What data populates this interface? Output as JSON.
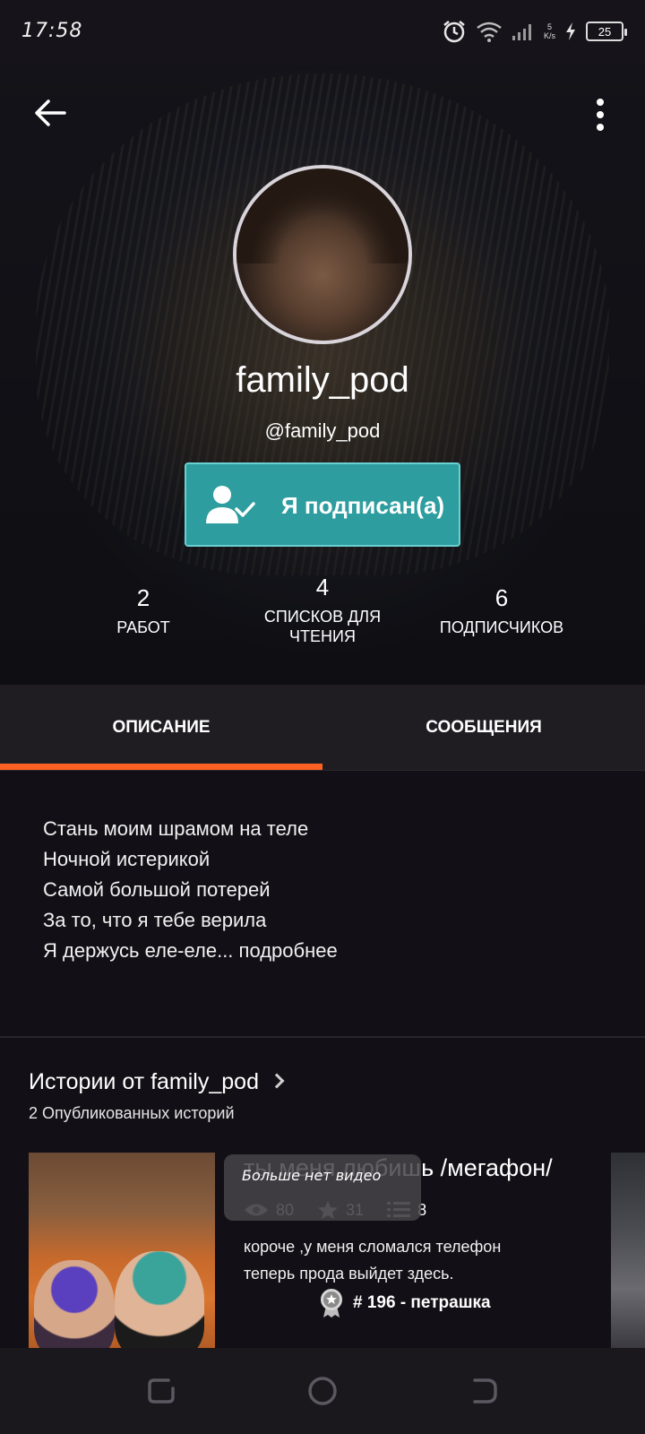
{
  "status_bar": {
    "time": "17:58",
    "net_speed_value": "5",
    "net_speed_unit": "K/s",
    "battery": "25",
    "icons": [
      "alarm-icon",
      "wifi-icon",
      "signal-icon",
      "charging-icon",
      "battery-icon"
    ]
  },
  "profile": {
    "display_name": "family_pod",
    "handle": "@family_pod",
    "follow_button": "Я подписан(а)",
    "stats": [
      {
        "value": "2",
        "label": "РАБОТ"
      },
      {
        "value": "4",
        "label": "СПИСКОВ ДЛЯ ЧТЕНИЯ"
      },
      {
        "value": "6",
        "label": "ПОДПИСЧИКОВ"
      }
    ]
  },
  "tabs": {
    "description": "ОПИСАНИЕ",
    "messages": "СООБЩЕНИЯ",
    "active": "description"
  },
  "about": {
    "lines": [
      "Стань моим шрамом на теле",
      "Ночной истерикой",
      "Самой большой потерей",
      "За то, что я тебе верила",
      "Я держусь еле-еле... подробнее"
    ]
  },
  "stories": {
    "title": "Истории от family_pod",
    "subtitle": "2 Опубликованных историй",
    "items": [
      {
        "title": "ты меня любишь /мегафон/",
        "reads": "80",
        "votes": "31",
        "parts": "8",
        "description_line1": "короче ,у меня сломался телефон",
        "description_line2": "теперь прода выйдет здесь.",
        "rank": "# 196 - петрашка"
      }
    ],
    "overlay_text": "Больше нет видео"
  },
  "colors": {
    "accent_orange": "#ff6122",
    "follow_teal": "#2e9d9f",
    "background": "#121016"
  }
}
